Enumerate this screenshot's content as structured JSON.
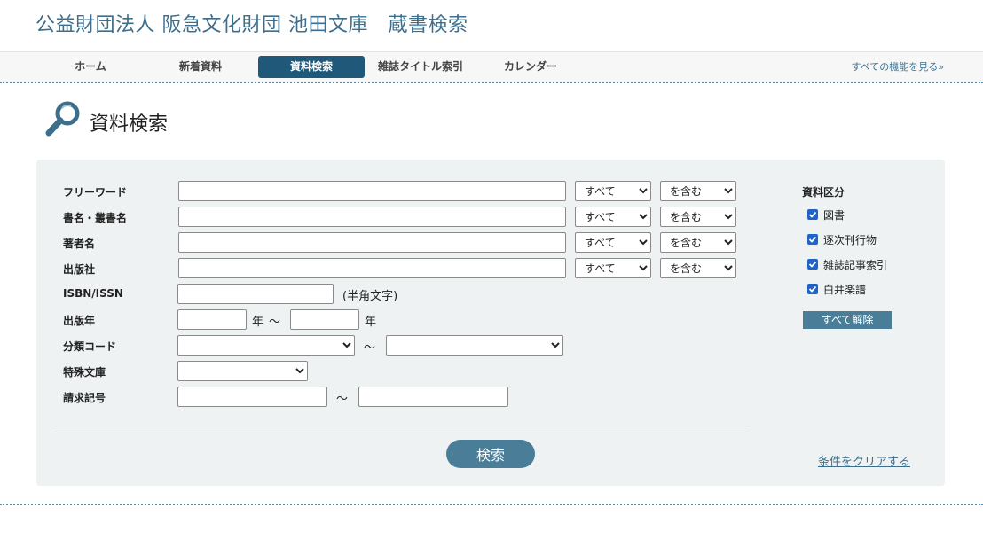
{
  "header": {
    "title": "公益財団法人 阪急文化財団 池田文庫　蔵書検索"
  },
  "nav": {
    "items": [
      "ホーム",
      "新着資料",
      "資料検索",
      "雑誌タイトル索引",
      "カレンダー"
    ],
    "active": "資料検索",
    "more": "すべての機能を見る»"
  },
  "page": {
    "title": "資料検索",
    "icon": "search-icon"
  },
  "form": {
    "fields": {
      "freeword": "フリーワード",
      "title": "書名・叢書名",
      "author": "著者名",
      "publisher": "出版社",
      "isbn": "ISBN/ISSN",
      "pubyear": "出版年",
      "classification": "分類コード",
      "special": "特殊文庫",
      "callno": "請求記号"
    },
    "scope_selected": "すべて",
    "match_selected": "を含む",
    "isbn_note": "(半角文字)",
    "year_unit": "年",
    "range_sep": "～",
    "search_button": "検索"
  },
  "material_type": {
    "title": "資料区分",
    "options": [
      {
        "label": "図書",
        "checked": true
      },
      {
        "label": "逐次刊行物",
        "checked": true
      },
      {
        "label": "雑誌記事索引",
        "checked": true
      },
      {
        "label": "白井楽譜",
        "checked": true
      }
    ],
    "clear_all_button": "すべて解除"
  },
  "clear_link": "条件をクリアする",
  "colors": {
    "brand": "#3d6f8c",
    "nav_active": "#1f5878",
    "button": "#4a7d97",
    "panel": "#eef2f3",
    "checkbox": "#1e63c8"
  }
}
